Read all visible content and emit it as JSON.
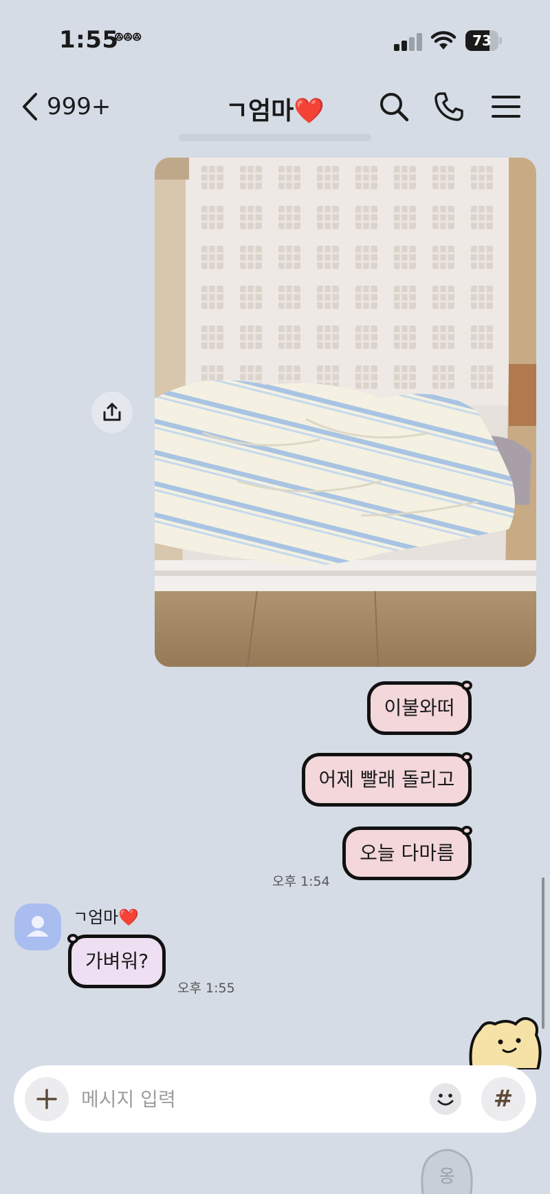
{
  "status_bar": {
    "time": "1:55",
    "extra": "ꔮꔮꔮ",
    "battery": "73",
    "battery_level": 0.73,
    "signal_bars_active": 2,
    "signal_bars_total": 4
  },
  "header": {
    "back_count": "999+",
    "title": "ㄱ엄마❤️"
  },
  "messages": {
    "outgoing": [
      {
        "text": "이불와떠"
      },
      {
        "text": "어제 빨래 돌리고"
      },
      {
        "text": "오늘 다마름"
      }
    ],
    "outgoing_time": "오후 1:54",
    "sender_name": "ㄱ엄마❤️",
    "incoming": [
      {
        "text": "가벼워?"
      }
    ],
    "incoming_time": "오후 1:55"
  },
  "input": {
    "placeholder": "메시지 입력",
    "hash_label": "#"
  },
  "sticker_preview": {
    "label": "옹"
  },
  "colors": {
    "background": "#d6dce6",
    "outgoing_bubble": "#f3d7da",
    "incoming_bubble": "#eee0f2",
    "avatar": "#a9bdf0"
  },
  "icons": [
    "back-chevron-icon",
    "search-icon",
    "phone-icon",
    "menu-icon",
    "share-icon",
    "plus-icon",
    "emoji-icon",
    "hash-icon",
    "signal-icon",
    "wifi-icon",
    "battery-icon"
  ]
}
